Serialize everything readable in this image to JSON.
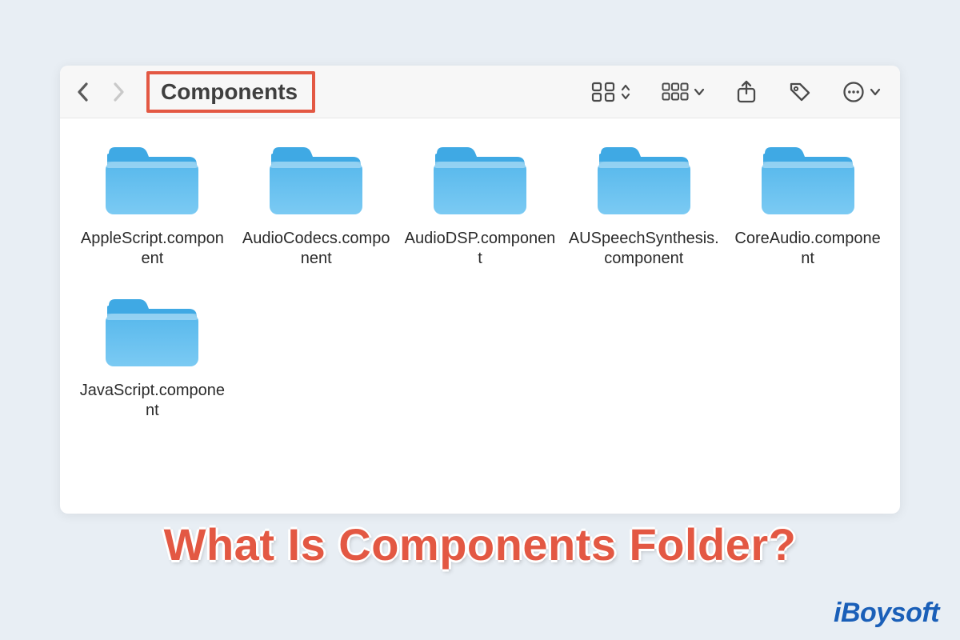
{
  "toolbar": {
    "title": "Components"
  },
  "folders": [
    {
      "name": "AppleScript.component"
    },
    {
      "name": "AudioCodecs.component"
    },
    {
      "name": "AudioDSP.component"
    },
    {
      "name": "AUSpeechSynthesis.component"
    },
    {
      "name": "CoreAudio.component"
    },
    {
      "name": "JavaScript.component"
    }
  ],
  "headline": "What Is Components Folder?",
  "brand": "iBoysoft",
  "colors": {
    "highlight": "#e35843",
    "folder_fill": "#57b8ec",
    "folder_tab": "#3fa9e4",
    "brand": "#1a5fb8"
  }
}
